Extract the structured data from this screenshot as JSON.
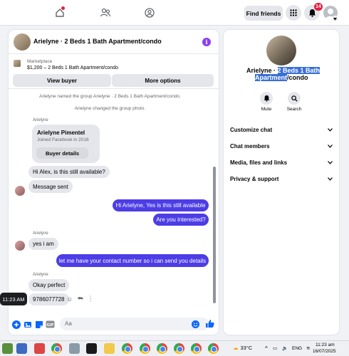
{
  "topnav": {
    "find_friends": "Find friends",
    "notification_count": "14"
  },
  "chat": {
    "title": "Arielyne · 2 Beds 1 Bath Apartment/condo",
    "marketplace_label": "Marketplace",
    "listing": "$1,200 – 2 Beds 1 Bath Apartment/condo",
    "view_buyer": "View buyer",
    "more_options": "More options",
    "system_msgs": [
      "Arielyne named the group Arielyne · 2 Beds 1 Bath Apartment/condo.",
      "Arielyne changed the group photo."
    ],
    "sender": "Arielyne",
    "card": {
      "name": "Arielyne Pimentel",
      "joined": "Joined Facebook in 2016",
      "button": "Buyer details"
    },
    "messages": [
      {
        "dir": "in",
        "text": "Hi Alex, is this still available?"
      },
      {
        "dir": "in",
        "text": "Message sent"
      },
      {
        "dir": "out",
        "text": "Hi Arielyne, Yes is this still available"
      },
      {
        "dir": "out",
        "text": "Are you interested?"
      },
      {
        "dir": "in",
        "text": "yes i am"
      },
      {
        "dir": "out",
        "text": "let me have your contact number so i can send you details"
      },
      {
        "dir": "in",
        "text": "Okay perfect"
      },
      {
        "dir": "in",
        "text": "9786077728"
      }
    ],
    "time_tooltip": "11:23 AM",
    "composer_placeholder": "Aa"
  },
  "info_panel": {
    "title_plain_1": "Arielyne · ",
    "title_sel_1": "2 Beds 1 Bath",
    "title_sel_2": "Apartment",
    "title_plain_2": "/condo",
    "mute": "Mute",
    "search": "Search",
    "sections": [
      "Customize chat",
      "Chat members",
      "Media, files and links",
      "Privacy & support"
    ]
  },
  "taskbar": {
    "temperature": "33°C",
    "lang": "ENG",
    "time": "11:23 am",
    "date": "16/07/2025"
  }
}
